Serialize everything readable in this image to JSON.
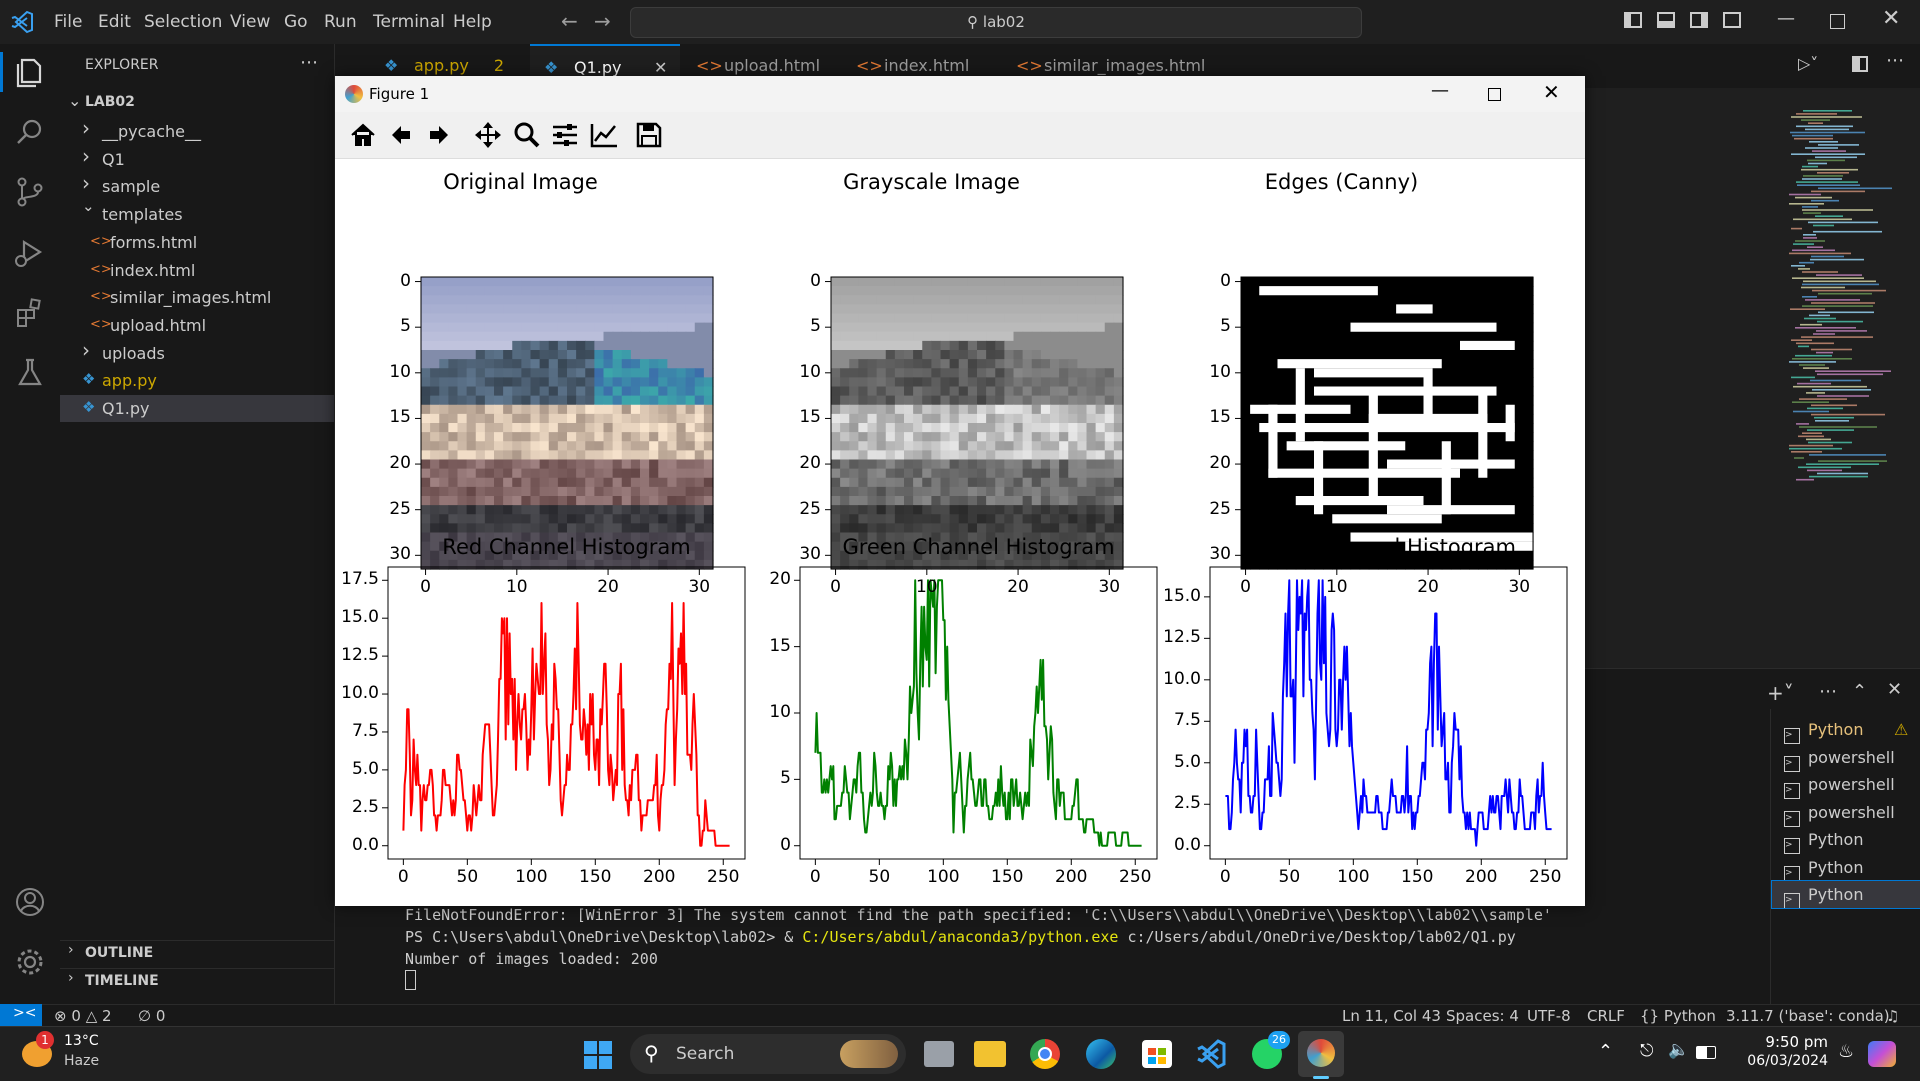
{
  "menubar": {
    "items": [
      "File",
      "Edit",
      "Selection",
      "View",
      "Go",
      "Run",
      "Terminal",
      "Help"
    ],
    "search": "lab02"
  },
  "sidebar": {
    "title": "EXPLORER",
    "root": "LAB02",
    "items": [
      {
        "label": "__pycache__",
        "type": "folder"
      },
      {
        "label": "Q1",
        "type": "folder"
      },
      {
        "label": "sample",
        "type": "folder"
      },
      {
        "label": "templates",
        "type": "folder-open"
      },
      {
        "label": "forms.html",
        "type": "html"
      },
      {
        "label": "index.html",
        "type": "html"
      },
      {
        "label": "similar_images.html",
        "type": "html"
      },
      {
        "label": "upload.html",
        "type": "html"
      },
      {
        "label": "uploads",
        "type": "folder"
      },
      {
        "label": "app.py",
        "type": "py"
      },
      {
        "label": "Q1.py",
        "type": "py"
      }
    ],
    "outline": "OUTLINE",
    "timeline": "TIMELINE"
  },
  "tabs": [
    {
      "label": "app.py",
      "badge": "2"
    },
    {
      "label": "Q1.py"
    },
    {
      "label": "upload.html"
    },
    {
      "label": "index.html"
    },
    {
      "label": "similar_images.html"
    }
  ],
  "figure": {
    "window_title": "Figure 1",
    "images": [
      {
        "title": "Original Image"
      },
      {
        "title": "Grayscale Image"
      },
      {
        "title": "Edges (Canny)"
      }
    ],
    "image_ticks": {
      "y": [
        "0",
        "5",
        "10",
        "15",
        "20",
        "25",
        "30"
      ],
      "x": [
        "0",
        "10",
        "20",
        "30"
      ]
    }
  },
  "chart_data": [
    {
      "type": "line",
      "title": "Red Channel Histogram",
      "color": "#ff0000",
      "ylim": [
        0,
        17.5
      ],
      "xlim": [
        0,
        255
      ],
      "xticks": [
        "0",
        "50",
        "100",
        "150",
        "200",
        "250"
      ],
      "yticks": [
        "0.0",
        "2.5",
        "5.0",
        "7.5",
        "10.0",
        "12.5",
        "15.0",
        "17.5"
      ],
      "keypoints": [
        [
          0,
          1
        ],
        [
          2,
          5
        ],
        [
          4,
          9
        ],
        [
          6,
          4
        ],
        [
          10,
          6
        ],
        [
          14,
          2
        ],
        [
          20,
          5
        ],
        [
          26,
          1
        ],
        [
          32,
          4
        ],
        [
          38,
          2
        ],
        [
          44,
          6
        ],
        [
          50,
          1
        ],
        [
          56,
          3
        ],
        [
          62,
          5
        ],
        [
          66,
          8
        ],
        [
          70,
          2
        ],
        [
          74,
          6
        ],
        [
          78,
          17
        ],
        [
          80,
          10
        ],
        [
          84,
          12
        ],
        [
          88,
          8
        ],
        [
          92,
          11
        ],
        [
          98,
          7
        ],
        [
          104,
          13
        ],
        [
          106,
          9
        ],
        [
          110,
          14
        ],
        [
          114,
          4
        ],
        [
          118,
          10
        ],
        [
          124,
          3
        ],
        [
          130,
          7
        ],
        [
          136,
          12
        ],
        [
          140,
          6
        ],
        [
          146,
          9
        ],
        [
          152,
          5
        ],
        [
          158,
          10
        ],
        [
          164,
          3
        ],
        [
          170,
          9
        ],
        [
          176,
          2
        ],
        [
          182,
          6
        ],
        [
          186,
          1
        ],
        [
          190,
          2
        ],
        [
          194,
          3
        ],
        [
          198,
          5
        ],
        [
          200,
          1
        ],
        [
          204,
          6
        ],
        [
          210,
          13
        ],
        [
          212,
          4
        ],
        [
          216,
          12
        ],
        [
          220,
          14
        ],
        [
          222,
          5
        ],
        [
          226,
          9
        ],
        [
          230,
          3
        ],
        [
          232,
          0
        ],
        [
          236,
          2
        ],
        [
          240,
          1
        ],
        [
          246,
          0
        ],
        [
          255,
          0
        ]
      ]
    },
    {
      "type": "line",
      "title": "Green Channel Histogram",
      "color": "#008000",
      "ylim": [
        0,
        20
      ],
      "xlim": [
        0,
        255
      ],
      "xticks": [
        "0",
        "50",
        "100",
        "150",
        "200",
        "250"
      ],
      "yticks": [
        "0",
        "5",
        "10",
        "15",
        "20"
      ],
      "keypoints": [
        [
          0,
          7
        ],
        [
          2,
          9
        ],
        [
          4,
          5
        ],
        [
          8,
          3
        ],
        [
          12,
          7
        ],
        [
          16,
          2
        ],
        [
          22,
          5
        ],
        [
          28,
          3
        ],
        [
          34,
          6
        ],
        [
          40,
          1
        ],
        [
          46,
          6
        ],
        [
          52,
          2
        ],
        [
          58,
          5
        ],
        [
          64,
          4
        ],
        [
          70,
          6
        ],
        [
          74,
          9
        ],
        [
          78,
          14
        ],
        [
          82,
          12
        ],
        [
          84,
          17
        ],
        [
          86,
          13
        ],
        [
          90,
          18
        ],
        [
          94,
          14
        ],
        [
          98,
          20
        ],
        [
          100,
          15
        ],
        [
          104,
          10
        ],
        [
          108,
          2
        ],
        [
          112,
          7
        ],
        [
          116,
          1
        ],
        [
          120,
          6
        ],
        [
          126,
          3
        ],
        [
          132,
          5
        ],
        [
          138,
          2
        ],
        [
          144,
          5
        ],
        [
          150,
          3
        ],
        [
          156,
          4
        ],
        [
          162,
          2
        ],
        [
          168,
          6
        ],
        [
          172,
          10
        ],
        [
          176,
          11
        ],
        [
          178,
          14
        ],
        [
          180,
          9
        ],
        [
          184,
          7
        ],
        [
          188,
          3
        ],
        [
          192,
          5
        ],
        [
          198,
          2
        ],
        [
          204,
          4
        ],
        [
          210,
          1
        ],
        [
          214,
          2
        ],
        [
          220,
          1
        ],
        [
          226,
          0
        ],
        [
          232,
          1
        ],
        [
          236,
          0
        ],
        [
          242,
          1
        ],
        [
          246,
          0
        ],
        [
          255,
          0
        ]
      ]
    },
    {
      "type": "line",
      "title": "Blue Channel Histogram",
      "color": "#0000ff",
      "ylim": [
        0,
        16
      ],
      "xlim": [
        0,
        255
      ],
      "xticks": [
        "0",
        "50",
        "100",
        "150",
        "200",
        "250"
      ],
      "yticks": [
        "0.0",
        "2.5",
        "5.0",
        "7.5",
        "10.0",
        "12.5",
        "15.0"
      ],
      "keypoints": [
        [
          0,
          3
        ],
        [
          4,
          1
        ],
        [
          8,
          6
        ],
        [
          12,
          3
        ],
        [
          16,
          8
        ],
        [
          20,
          2
        ],
        [
          24,
          5
        ],
        [
          28,
          1
        ],
        [
          32,
          4
        ],
        [
          38,
          6
        ],
        [
          42,
          3
        ],
        [
          46,
          8
        ],
        [
          50,
          16
        ],
        [
          52,
          12
        ],
        [
          54,
          9
        ],
        [
          58,
          14
        ],
        [
          62,
          11
        ],
        [
          66,
          16
        ],
        [
          68,
          9
        ],
        [
          70,
          4
        ],
        [
          72,
          11
        ],
        [
          74,
          16
        ],
        [
          78,
          13
        ],
        [
          80,
          8
        ],
        [
          84,
          11
        ],
        [
          88,
          6
        ],
        [
          92,
          12
        ],
        [
          96,
          9
        ],
        [
          100,
          4
        ],
        [
          104,
          1
        ],
        [
          108,
          4
        ],
        [
          112,
          2
        ],
        [
          118,
          4
        ],
        [
          124,
          1
        ],
        [
          130,
          3
        ],
        [
          136,
          2
        ],
        [
          142,
          4
        ],
        [
          148,
          1
        ],
        [
          152,
          3
        ],
        [
          156,
          5
        ],
        [
          160,
          8
        ],
        [
          164,
          11
        ],
        [
          168,
          8
        ],
        [
          172,
          6
        ],
        [
          176,
          3
        ],
        [
          180,
          8
        ],
        [
          184,
          5
        ],
        [
          188,
          1
        ],
        [
          192,
          2
        ],
        [
          196,
          0
        ],
        [
          200,
          3
        ],
        [
          204,
          1
        ],
        [
          210,
          3
        ],
        [
          216,
          2
        ],
        [
          222,
          4
        ],
        [
          226,
          1
        ],
        [
          230,
          3
        ],
        [
          236,
          1
        ],
        [
          242,
          2
        ],
        [
          248,
          4
        ],
        [
          252,
          1
        ],
        [
          255,
          1
        ]
      ]
    }
  ],
  "terminal": {
    "lines": [
      "FileNotFoundError: [WinError 3] The system cannot find the path specified: 'C:\\\\Users\\\\abdul\\\\OneDrive\\\\Desktop\\\\lab02\\\\sample'",
      "Number of images loaded: 200"
    ],
    "prompt": "PS C:\\Users\\abdul\\OneDrive\\Desktop\\lab02> & ",
    "cmd_exe": "C:/Users/abdul/anaconda3/python.exe",
    "cmd_arg": " c:/Users/abdul/OneDrive/Desktop/lab02/Q1.py",
    "list": [
      "Python",
      "powershell",
      "powershell",
      "powershell",
      "Python",
      "Python",
      "Python"
    ]
  },
  "statusbar": {
    "errors": "0",
    "warnings": "2",
    "ports": "0",
    "position": "Ln 11, Col 43",
    "spaces": "Spaces: 4",
    "encoding": "UTF-8",
    "eol": "CRLF",
    "language": "Python",
    "interpreter": "3.11.7 ('base': conda)"
  },
  "taskbar": {
    "temp": "13°C",
    "weather": "Haze",
    "search": "Search",
    "time": "9:50 pm",
    "date": "06/03/2024",
    "notif": "1",
    "whatsapp": "26"
  }
}
